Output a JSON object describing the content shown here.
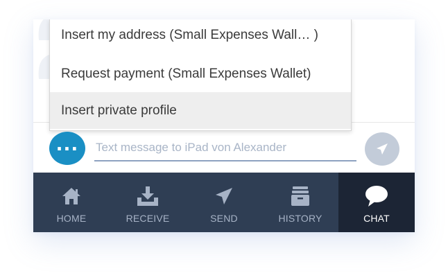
{
  "menu": {
    "items": [
      {
        "label": "Insert my address (Small Expenses Wall… )"
      },
      {
        "label": "Request payment (Small Expenses Wallet)"
      },
      {
        "label": "Insert private profile"
      }
    ]
  },
  "composer": {
    "more_icon": "more-dots-icon",
    "placeholder": "Text message to iPad von Alexander",
    "send_icon": "send-arrow-icon"
  },
  "tabs": [
    {
      "label": "HOME",
      "icon": "home-icon"
    },
    {
      "label": "RECEIVE",
      "icon": "receive-icon"
    },
    {
      "label": "SEND",
      "icon": "send-icon"
    },
    {
      "label": "HISTORY",
      "icon": "history-icon"
    },
    {
      "label": "CHAT",
      "icon": "chat-icon",
      "active": true
    }
  ],
  "colors": {
    "accent": "#1a8fc4",
    "tabbar": "#2f3e54",
    "tabbar_active": "#1c2535",
    "send_disabled": "#c3ccd9",
    "menu_highlight": "#eeeeee"
  }
}
